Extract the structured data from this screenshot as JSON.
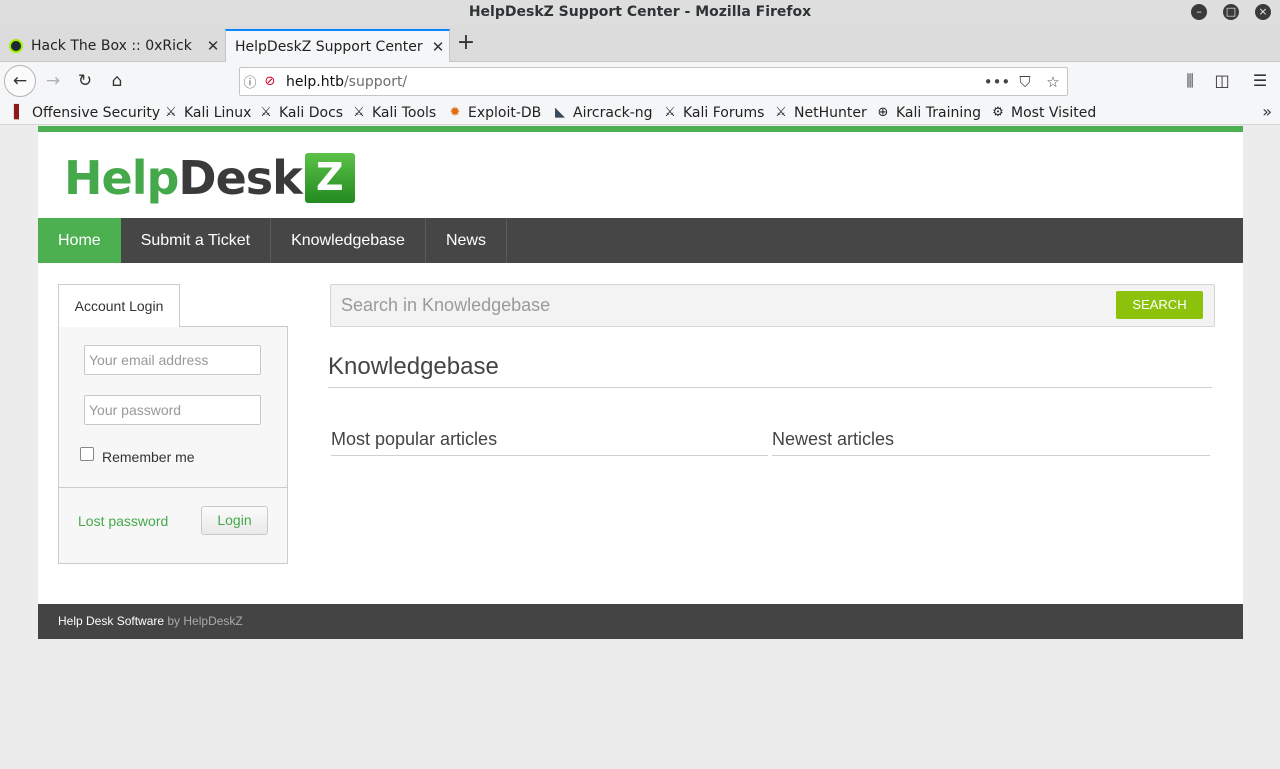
{
  "window": {
    "title": "HelpDeskZ Support Center - Mozilla Firefox",
    "minimize": "–",
    "maximize": "□",
    "close": "×"
  },
  "tabs": [
    {
      "label": "Hack The Box :: 0xRick",
      "close": "✕"
    },
    {
      "label": "HelpDeskZ Support Center",
      "close": "✕"
    }
  ],
  "newtab": "+",
  "nav": {
    "back": "←",
    "forward": "→",
    "reload": "↻",
    "home": "⌂",
    "url_host": "help.htb",
    "url_path": "/support/",
    "more": "•••",
    "pocket": "⛉",
    "bookmark": "☆",
    "library": "⫼",
    "sidebar": "◫",
    "menu": "☰"
  },
  "bookmarks": [
    {
      "label": "Offensive Security",
      "icon": "offsec-icon",
      "glyph": "▌"
    },
    {
      "label": "Kali Linux",
      "icon": "kali-icon",
      "glyph": "⚔"
    },
    {
      "label": "Kali Docs",
      "icon": "kali-icon",
      "glyph": "⚔"
    },
    {
      "label": "Kali Tools",
      "icon": "kali-icon",
      "glyph": "⚔"
    },
    {
      "label": "Exploit-DB",
      "icon": "exploitdb-icon",
      "glyph": "✹"
    },
    {
      "label": "Aircrack-ng",
      "icon": "aircrack-icon",
      "glyph": "◣"
    },
    {
      "label": "Kali Forums",
      "icon": "kali-icon",
      "glyph": "⚔"
    },
    {
      "label": "NetHunter",
      "icon": "kali-icon",
      "glyph": "⚔"
    },
    {
      "label": "Kali Training",
      "icon": "globe-icon",
      "glyph": "⊕"
    },
    {
      "label": "Most Visited",
      "icon": "gear-icon",
      "glyph": "⚙"
    }
  ],
  "bookmarks_more": "»",
  "site": {
    "logo_part1": "Help",
    "logo_part2": "Desk",
    "logo_z": "Z",
    "menu": [
      "Home",
      "Submit a Ticket",
      "Knowledgebase",
      "News"
    ],
    "login": {
      "tab_label": "Account Login",
      "email_placeholder": "Your email address",
      "password_placeholder": "Your password",
      "remember_label": "Remember me",
      "lost_password": "Lost password",
      "login_button": "Login"
    },
    "search": {
      "placeholder": "Search in Knowledgebase",
      "button": "SEARCH"
    },
    "kb_title": "Knowledgebase",
    "popular_heading": "Most popular articles",
    "newest_heading": "Newest articles",
    "footer_link": "Help Desk Software",
    "footer_text": " by HelpDeskZ"
  },
  "colors": {
    "accent_green": "#4caf50",
    "search_button": "#8cc20c",
    "menu_bg": "#464646",
    "footer_bg": "#444444",
    "tab_highlight": "#0a84ff"
  }
}
